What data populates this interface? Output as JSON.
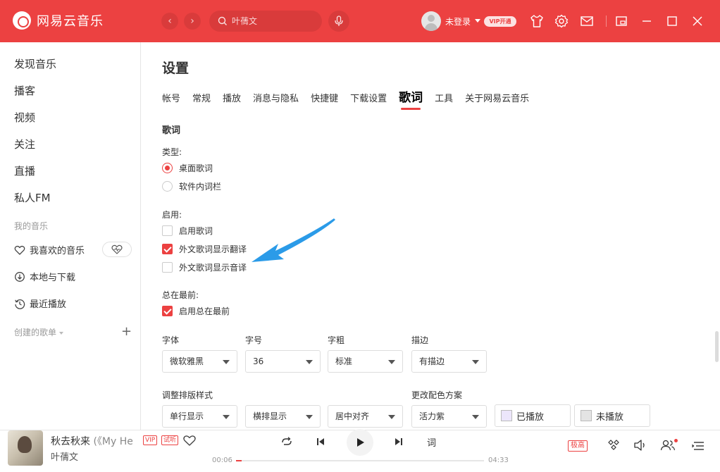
{
  "header": {
    "app_name": "网易云音乐",
    "back_icon": "chevron-left-icon",
    "forward_icon": "chevron-right-icon",
    "search_placeholder": "叶蒨文",
    "user_label": "未登录",
    "vip_label": "VIP开通",
    "accent_color": "#ec4141"
  },
  "sidebar": {
    "items": [
      {
        "label": "发现音乐"
      },
      {
        "label": "播客"
      },
      {
        "label": "视频"
      },
      {
        "label": "关注"
      },
      {
        "label": "直播"
      },
      {
        "label": "私人FM"
      }
    ],
    "my_music_title": "我的音乐",
    "my_music": [
      {
        "label": "我喜欢的音乐",
        "icon": "heart-icon"
      },
      {
        "label": "本地与下载",
        "icon": "download-icon"
      },
      {
        "label": "最近播放",
        "icon": "history-icon"
      }
    ],
    "created_playlists_title": "创建的歌单"
  },
  "settings": {
    "title": "设置",
    "tabs": [
      {
        "label": "帐号",
        "active": false
      },
      {
        "label": "常规",
        "active": false
      },
      {
        "label": "播放",
        "active": false
      },
      {
        "label": "消息与隐私",
        "active": false
      },
      {
        "label": "快捷键",
        "active": false
      },
      {
        "label": "下载设置",
        "active": false
      },
      {
        "label": "歌词",
        "active": true
      },
      {
        "label": "工具",
        "active": false
      },
      {
        "label": "关于网易云音乐",
        "active": false
      }
    ],
    "section_title": "歌词",
    "type": {
      "label": "类型:",
      "options": [
        {
          "label": "桌面歌词",
          "selected": true
        },
        {
          "label": "软件内词栏",
          "selected": false
        }
      ]
    },
    "enable": {
      "label": "启用:",
      "options": [
        {
          "label": "启用歌词",
          "checked": false
        },
        {
          "label": "外文歌词显示翻译",
          "checked": true
        },
        {
          "label": "外文歌词显示音译",
          "checked": false
        }
      ]
    },
    "always_on_top": {
      "label": "总在最前:",
      "options": [
        {
          "label": "启用总在最前",
          "checked": true
        }
      ]
    },
    "font": {
      "font_label": "字体",
      "font_value": "微软雅黑",
      "size_label": "字号",
      "size_value": "36",
      "weight_label": "字粗",
      "weight_value": "标准",
      "stroke_label": "描边",
      "stroke_value": "有描边"
    },
    "layout": {
      "label": "调整排版样式",
      "line_value": "单行显示",
      "direction_value": "横排显示",
      "align_value": "居中对齐"
    },
    "color_scheme": {
      "label": "更改配色方案",
      "scheme_value": "活力紫",
      "played_label": "已播放",
      "unplayed_label": "未播放"
    }
  },
  "player": {
    "song_title": "秋去秋来",
    "song_subtitle": "(《My He",
    "vip_tag": "VIP",
    "trial_tag": "试听",
    "artist": "叶蒨文",
    "lyric_button": "词",
    "current_time": "00:06",
    "total_time": "04:33",
    "progress": 0.022,
    "quality": "极高"
  }
}
